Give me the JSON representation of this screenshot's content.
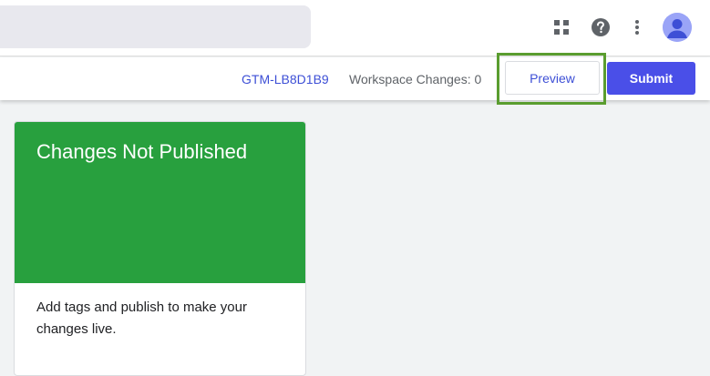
{
  "topbar": {
    "icons": [
      "apps-grid-icon",
      "help-icon",
      "more-vert-icon",
      "account-avatar-icon"
    ]
  },
  "workspace": {
    "container_id": "GTM-LB8D1B9",
    "changes_text": "Workspace Changes: 0",
    "preview_label": "Preview",
    "submit_label": "Submit"
  },
  "card": {
    "title": "Changes Not Published",
    "body": "Add tags and publish to make your changes live."
  },
  "colors": {
    "accent": "#4a4fe8",
    "card_green": "#28a03e",
    "highlight": "#5a9d2f",
    "link": "#3d4fd6"
  }
}
